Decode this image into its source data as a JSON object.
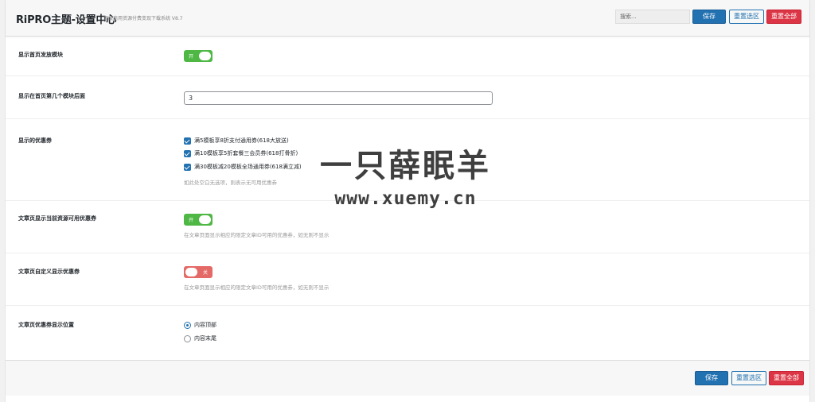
{
  "header": {
    "title": "RiPRO主题-设置中心",
    "subtitle": "顶级商用资源付费变现下载系统 V8.7",
    "search_placeholder": "搜索...",
    "save_label": "保存",
    "reset_section_label": "重置选区",
    "reset_all_label": "重置全部"
  },
  "settings": {
    "show_home_coupon_module": {
      "label": "显示首页发放模块",
      "state": "开",
      "enabled": true
    },
    "home_module_position": {
      "label": "显示在首页第几个模块后面",
      "value": "3"
    },
    "coupons": {
      "label": "显示的优惠券",
      "options": [
        {
          "label": "满5模板享8折支付通用券(618大放送)",
          "checked": true
        },
        {
          "label": "满10模板享5折套餐三会员券(618打骨折)",
          "checked": true
        },
        {
          "label": "满30模板减20模板全场通用券(618满立减)",
          "checked": true
        }
      ],
      "description": "如此处空白无选项，则表示无可用优惠券"
    },
    "post_show_current_coupons": {
      "label": "文章页显示当前资源可用优惠券",
      "state": "开",
      "enabled": true,
      "description": "在文章页面显示相应的限定文章ID可用的优惠券，如无则不显示"
    },
    "post_custom_coupons": {
      "label": "文章页自定义显示优惠券",
      "state": "关",
      "enabled": false,
      "description": "在文章页面显示相应的限定文章ID可用的优惠券，如无则不显示"
    },
    "post_coupon_position": {
      "label": "文章页优惠券显示位置",
      "options": [
        {
          "label": "内容顶部",
          "selected": true
        },
        {
          "label": "内容末尾",
          "selected": false
        }
      ]
    }
  },
  "footer": {
    "save_label": "保存",
    "reset_section_label": "重置选区",
    "reset_all_label": "重置全部"
  },
  "watermark": {
    "title": "一只薛眠羊",
    "url": "www.xuemy.cn"
  },
  "colors": {
    "primary": "#2271b1",
    "danger": "#dc3545",
    "switch_on": "#4fb845",
    "switch_off": "#e36a66"
  }
}
